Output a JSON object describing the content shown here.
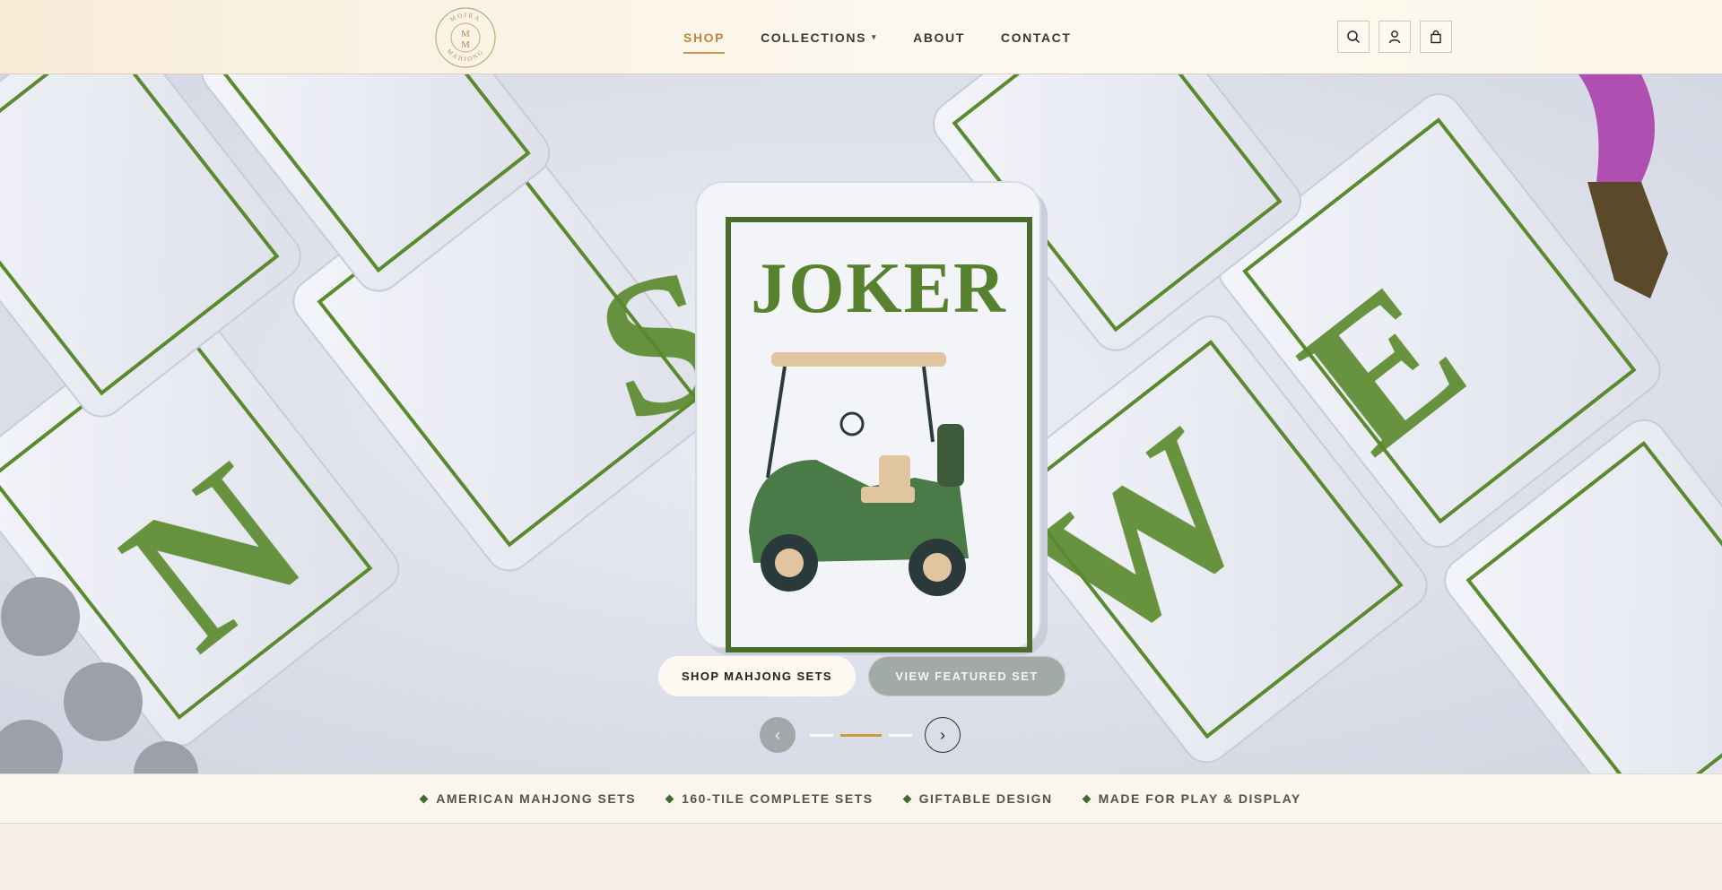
{
  "brand": {
    "logo_top_text": "MOIRA",
    "logo_monogram_top": "M",
    "logo_monogram_bottom": "M",
    "logo_bottom_text": "MAHJONG"
  },
  "nav": {
    "items": [
      {
        "label": "SHOP",
        "active": true
      },
      {
        "label": "COLLECTIONS",
        "has_dropdown": true
      },
      {
        "label": "ABOUT"
      },
      {
        "label": "CONTACT"
      }
    ],
    "dropdown_glyph": "▾"
  },
  "header_icons": [
    "search-icon",
    "account-icon",
    "bag-icon"
  ],
  "hero": {
    "tile_text": "JOKER",
    "tile_letters": [
      "S",
      "N",
      "W",
      "E"
    ],
    "primary_cta": "SHOP MAHJONG SETS",
    "secondary_cta": "VIEW FEATURED SET",
    "prev_glyph": "‹",
    "next_glyph": "›",
    "slide_count": 3,
    "active_slide": 2
  },
  "features": [
    "AMERICAN MAHJONG SETS",
    "160-TILE COMPLETE SETS",
    "GIFTABLE DESIGN",
    "MADE FOR PLAY & DISPLAY"
  ],
  "colors": {
    "accent_gold": "#c9974a",
    "tile_green": "#5b8a2e",
    "feature_diamond": "#3f6b32",
    "strip_bg": "#faf6ee"
  }
}
